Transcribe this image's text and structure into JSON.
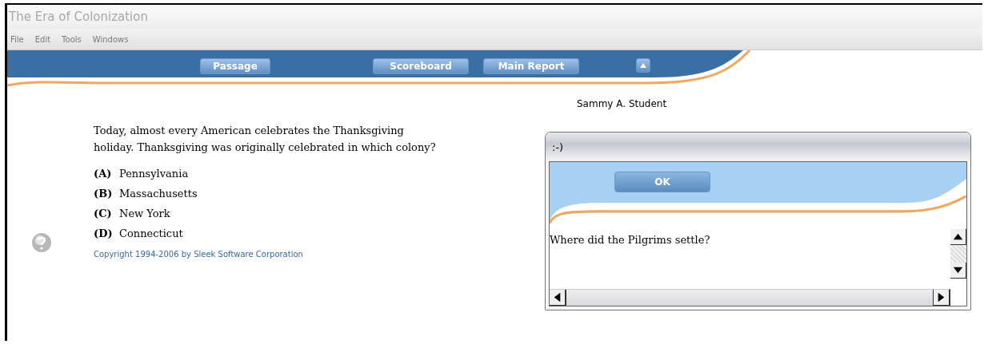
{
  "window": {
    "title": "The Era of Colonization"
  },
  "menu_bar": [
    "File",
    "Edit",
    "Tools",
    "Windows"
  ],
  "toolbar": {
    "buttons": [
      "Passage",
      "Scoreboard",
      "Main Report"
    ]
  },
  "student_name": "Sammy A. Student",
  "question": {
    "text": "Today, almost every American celebrates the Thanksgiving holiday. Thanksgiving was originally celebrated in which colony?",
    "options": [
      {
        "letter": "(A)",
        "text": "Pennsylvania"
      },
      {
        "letter": "(B)",
        "text": "Massachusetts"
      },
      {
        "letter": "(C)",
        "text": "New York"
      },
      {
        "letter": "(D)",
        "text": "Connecticut"
      }
    ]
  },
  "copyright": "Copyright 1994-2006 by Sleek Software Corporation",
  "dialog": {
    "title": ":-)",
    "button": "OK",
    "message": "Where did the Pilgrims settle?"
  }
}
